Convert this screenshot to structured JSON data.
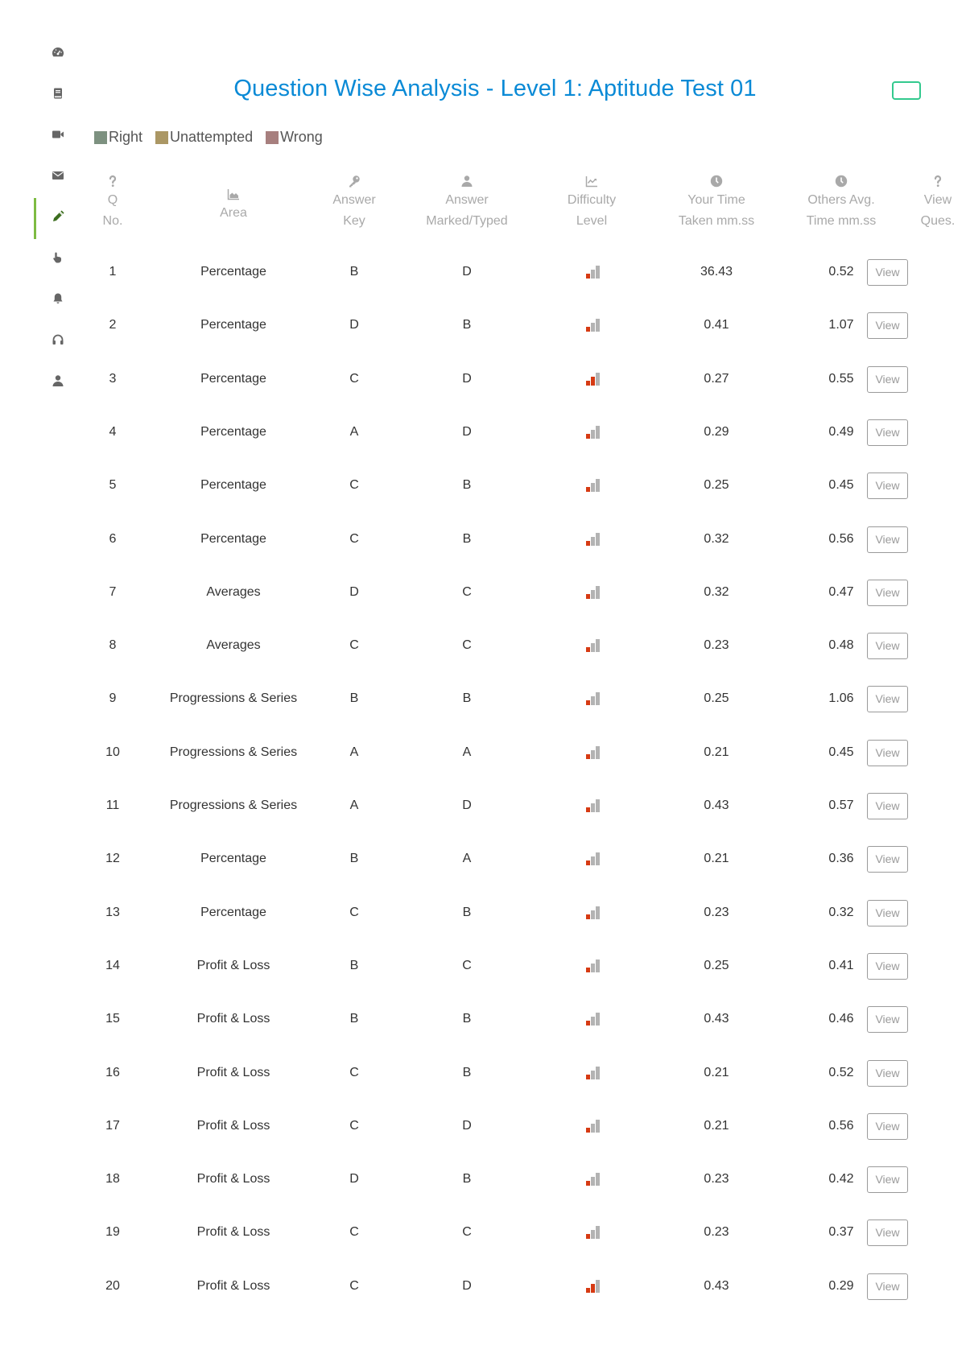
{
  "sidebar": {
    "items": [
      {
        "name": "dashboard",
        "icon": "dashboard-icon",
        "active": false
      },
      {
        "name": "book",
        "icon": "book-icon",
        "active": false
      },
      {
        "name": "video",
        "icon": "video-icon",
        "active": false
      },
      {
        "name": "mail",
        "icon": "mail-icon",
        "active": false
      },
      {
        "name": "tests",
        "icon": "pencil-icon",
        "active": true
      },
      {
        "name": "practice",
        "icon": "pointer-hand-icon",
        "active": false
      },
      {
        "name": "notifications",
        "icon": "bell-icon",
        "active": false
      },
      {
        "name": "support",
        "icon": "headphones-icon",
        "active": false
      },
      {
        "name": "profile",
        "icon": "user-icon",
        "active": false
      }
    ],
    "active_color": "#7dbb42"
  },
  "header": {
    "title": "Question Wise Analysis - Level 1: Aptitude Test 01",
    "title_color": "#0a8ad6",
    "action_button_border": "#33c98e"
  },
  "legend": [
    {
      "label": "Right",
      "color": "#7d9180"
    },
    {
      "label": "Unattempted",
      "color": "#ab9764"
    },
    {
      "label": "Wrong",
      "color": "#a77f7e"
    }
  ],
  "table": {
    "columns": [
      {
        "key": "q",
        "icon": "question-icon",
        "line1": "Q",
        "line2": "No."
      },
      {
        "key": "area",
        "icon": "area-chart-icon",
        "line1": "Area",
        "line2": ""
      },
      {
        "key": "key",
        "icon": "key-icon",
        "line1": "Answer",
        "line2": "Key"
      },
      {
        "key": "mark",
        "icon": "user-icon",
        "line1": "Answer",
        "line2": "Marked/Typed"
      },
      {
        "key": "diff",
        "icon": "line-chart-icon",
        "line1": "Difficulty",
        "line2": "Level"
      },
      {
        "key": "your",
        "icon": "clock-icon",
        "line1": "Your Time",
        "line2": "Taken mm.ss"
      },
      {
        "key": "oth",
        "icon": "clock-icon",
        "line1": "Others Avg.",
        "line2": "Time mm.ss"
      },
      {
        "key": "view",
        "icon": "question-icon",
        "line1": "View",
        "line2": "Ques."
      }
    ],
    "view_label": "View",
    "difficulty_max": 3,
    "rows": [
      {
        "q": "1",
        "area": "Percentage",
        "key": "B",
        "mark": "D",
        "difficulty": 1,
        "your": "36.43",
        "others": "0.52"
      },
      {
        "q": "2",
        "area": "Percentage",
        "key": "D",
        "mark": "B",
        "difficulty": 1,
        "your": "0.41",
        "others": "1.07"
      },
      {
        "q": "3",
        "area": "Percentage",
        "key": "C",
        "mark": "D",
        "difficulty": 2,
        "your": "0.27",
        "others": "0.55"
      },
      {
        "q": "4",
        "area": "Percentage",
        "key": "A",
        "mark": "D",
        "difficulty": 1,
        "your": "0.29",
        "others": "0.49"
      },
      {
        "q": "5",
        "area": "Percentage",
        "key": "C",
        "mark": "B",
        "difficulty": 1,
        "your": "0.25",
        "others": "0.45"
      },
      {
        "q": "6",
        "area": "Percentage",
        "key": "C",
        "mark": "B",
        "difficulty": 1,
        "your": "0.32",
        "others": "0.56"
      },
      {
        "q": "7",
        "area": "Averages",
        "key": "D",
        "mark": "C",
        "difficulty": 1,
        "your": "0.32",
        "others": "0.47"
      },
      {
        "q": "8",
        "area": "Averages",
        "key": "C",
        "mark": "C",
        "difficulty": 1,
        "your": "0.23",
        "others": "0.48"
      },
      {
        "q": "9",
        "area": "Progressions & Series",
        "key": "B",
        "mark": "B",
        "difficulty": 1,
        "your": "0.25",
        "others": "1.06"
      },
      {
        "q": "10",
        "area": "Progressions & Series",
        "key": "A",
        "mark": "A",
        "difficulty": 1,
        "your": "0.21",
        "others": "0.45"
      },
      {
        "q": "11",
        "area": "Progressions & Series",
        "key": "A",
        "mark": "D",
        "difficulty": 1,
        "your": "0.43",
        "others": "0.57"
      },
      {
        "q": "12",
        "area": "Percentage",
        "key": "B",
        "mark": "A",
        "difficulty": 1,
        "your": "0.21",
        "others": "0.36"
      },
      {
        "q": "13",
        "area": "Percentage",
        "key": "C",
        "mark": "B",
        "difficulty": 1,
        "your": "0.23",
        "others": "0.32"
      },
      {
        "q": "14",
        "area": "Profit & Loss",
        "key": "B",
        "mark": "C",
        "difficulty": 1,
        "your": "0.25",
        "others": "0.41"
      },
      {
        "q": "15",
        "area": "Profit & Loss",
        "key": "B",
        "mark": "B",
        "difficulty": 1,
        "your": "0.43",
        "others": "0.46"
      },
      {
        "q": "16",
        "area": "Profit & Loss",
        "key": "C",
        "mark": "B",
        "difficulty": 1,
        "your": "0.21",
        "others": "0.52"
      },
      {
        "q": "17",
        "area": "Profit & Loss",
        "key": "C",
        "mark": "D",
        "difficulty": 1,
        "your": "0.21",
        "others": "0.56"
      },
      {
        "q": "18",
        "area": "Profit & Loss",
        "key": "D",
        "mark": "B",
        "difficulty": 1,
        "your": "0.23",
        "others": "0.42"
      },
      {
        "q": "19",
        "area": "Profit & Loss",
        "key": "C",
        "mark": "C",
        "difficulty": 1,
        "your": "0.23",
        "others": "0.37"
      },
      {
        "q": "20",
        "area": "Profit & Loss",
        "key": "C",
        "mark": "D",
        "difficulty": 2,
        "your": "0.43",
        "others": "0.29"
      }
    ]
  }
}
